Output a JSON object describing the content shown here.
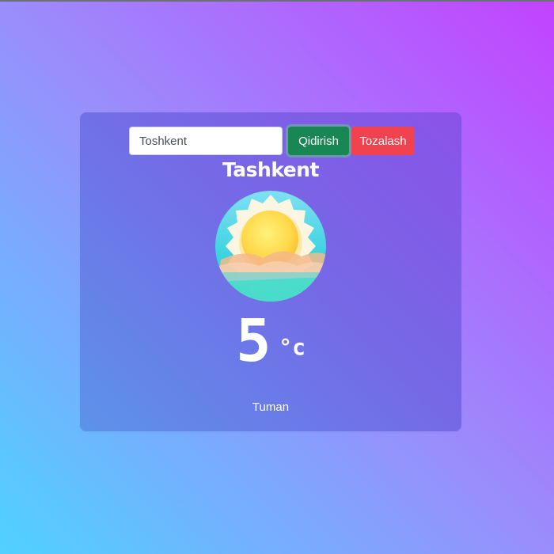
{
  "search": {
    "value": "Toshkent",
    "search_label": "Qidirish",
    "clear_label": "Tozalash"
  },
  "weather": {
    "city": "Tashkent",
    "icon": "sunny-weather-icon",
    "temperature": "5",
    "unit": "°c",
    "description": "Tuman"
  },
  "colors": {
    "search_button": "#198754",
    "clear_button": "#f0434f",
    "sun": "#ffd54a",
    "icon_circle": "#39d8e0"
  }
}
